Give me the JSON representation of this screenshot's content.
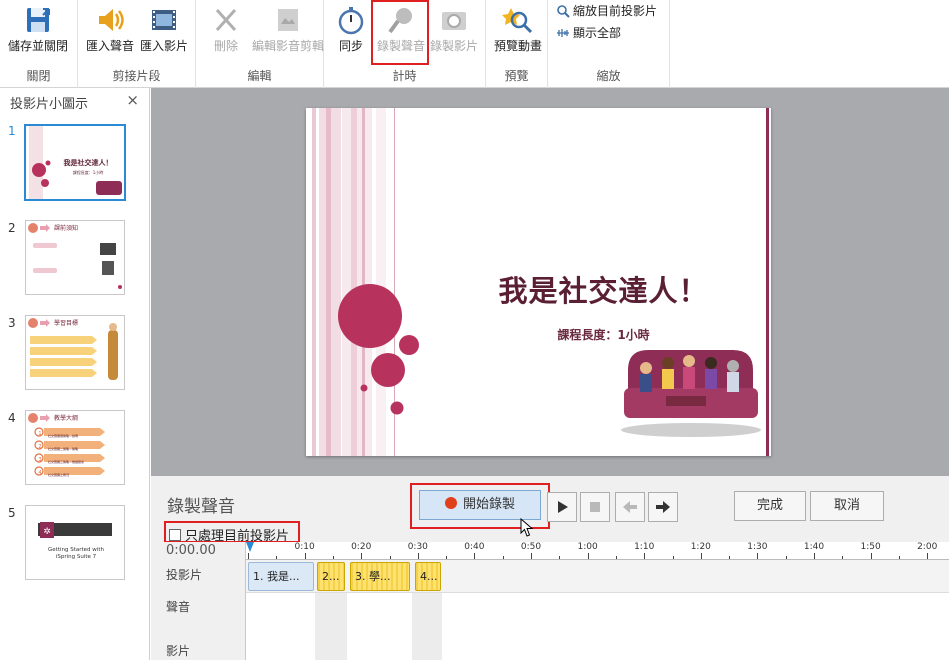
{
  "ribbon": {
    "groups": [
      {
        "label": "關閉",
        "buttons": [
          "儲存並關閉"
        ]
      },
      {
        "label": "剪接片段",
        "buttons": [
          "匯入聲音",
          "匯入影片"
        ]
      },
      {
        "label": "編輯",
        "buttons": [
          "刪除",
          "編輯影音剪輯"
        ]
      },
      {
        "label": "計時",
        "buttons": [
          "同步",
          "錄製聲音",
          "錄製影片"
        ]
      },
      {
        "label": "預覽",
        "buttons": [
          "預覽動畫"
        ]
      },
      {
        "label": "縮放",
        "buttons": [
          "縮放目前投影片",
          "顯示全部"
        ]
      }
    ]
  },
  "panel": {
    "title": "投影片小圖示",
    "close": "×",
    "numbers": [
      "1",
      "2",
      "3",
      "4",
      "5"
    ]
  },
  "thumbs": {
    "t1_title": "我是社交達人！",
    "t1_sub": "課程長度：1小時",
    "t2_title": "課前須知",
    "t3_title": "學習目標",
    "t4_title": "教學大綱",
    "t4_items": [
      "社交圈擴展策略－說明",
      "社交圈擴二策略－策略",
      "社交圈擴三策略－維護關係",
      "社交圈擴之概況"
    ],
    "t4_nums": [
      "1",
      "2",
      "3",
      "4"
    ],
    "t5_line1": "Getting Started with",
    "t5_line2": "iSpring Suite 7"
  },
  "slide": {
    "title": "我是社交達人！",
    "subtitle": "課程長度：1小時"
  },
  "recbar": {
    "title": "錄製聲音",
    "start": "開始錄製",
    "done": "完成",
    "cancel": "取消",
    "only_current": "只處理目前投影片"
  },
  "timeline": {
    "readout": "0:00.00",
    "rows": [
      "投影片",
      "聲音",
      "影片"
    ],
    "ticks": [
      "0:10",
      "0:20",
      "0:30",
      "0:40",
      "0:50",
      "1:00",
      "1:10",
      "1:20",
      "1:30",
      "1:40",
      "1:50",
      "2:00"
    ],
    "clips": [
      "1. 我是...",
      "2...",
      "3. 學...",
      "4..."
    ]
  },
  "colors": {
    "accent": "#2a8ad4",
    "highlight": "#e02020",
    "slide_title": "#5b1f34",
    "circle": "#b8325e"
  }
}
